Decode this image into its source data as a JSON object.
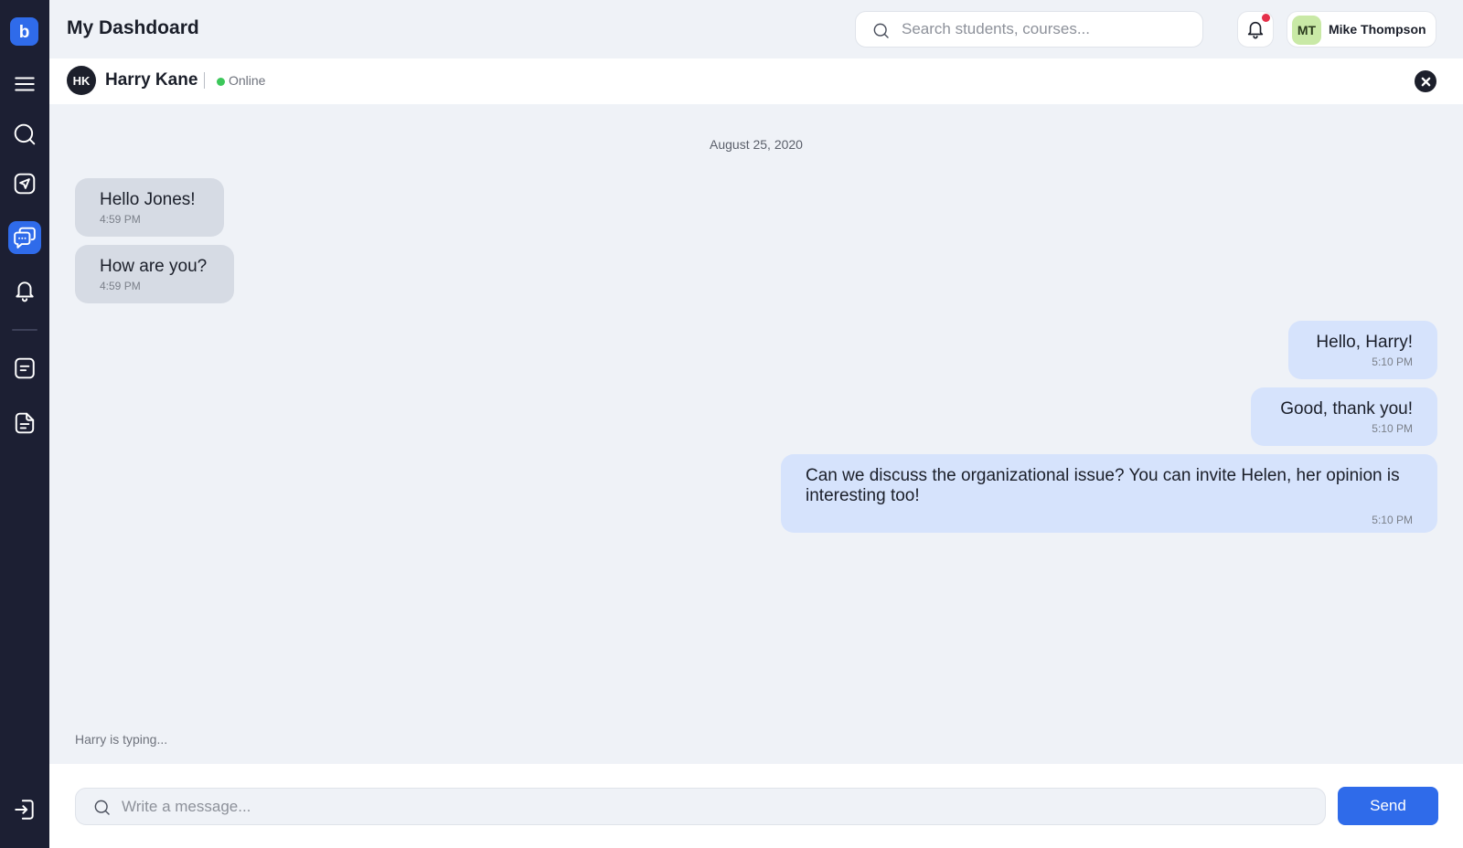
{
  "app": {
    "logo_letter": "b",
    "title": "My Dashdoard"
  },
  "sidebar": {
    "items": [
      {
        "icon": "menu-icon"
      },
      {
        "icon": "search-icon"
      },
      {
        "icon": "send-icon"
      },
      {
        "icon": "chat-icon",
        "active": true
      },
      {
        "icon": "bell-icon"
      },
      {
        "icon": "note-icon"
      },
      {
        "icon": "document-icon"
      },
      {
        "icon": "logout-icon"
      }
    ]
  },
  "header": {
    "search_placeholder": "Search students, courses...",
    "notification_dot_color": "#e5304a",
    "user": {
      "initials": "MT",
      "name": "Mike Thompson"
    }
  },
  "chat": {
    "contact": {
      "initials": "HK",
      "name": "Harry Kane",
      "status": "Online"
    },
    "date": "August 25, 2020",
    "messages": [
      {
        "direction": "in",
        "text": "Hello Jones!",
        "time": "4:59 PM"
      },
      {
        "direction": "in",
        "text": "How are you?",
        "time": "4:59 PM"
      },
      {
        "direction": "out",
        "text": "Hello, Harry!",
        "time": "5:10 PM"
      },
      {
        "direction": "out",
        "text": "Good, thank you!",
        "time": "5:10 PM"
      },
      {
        "direction": "out",
        "text": "Can we discuss the organizational issue? You can invite Helen, her opinion is interesting too!",
        "time": "5:10 PM"
      }
    ],
    "typing": "Harry is typing..."
  },
  "composer": {
    "placeholder": "Write a message...",
    "send_label": "Send"
  },
  "colors": {
    "accent": "#2f6bea",
    "sidebar": "#1c1f33",
    "online": "#3cc75a",
    "incoming_bubble": "#d6dbe4",
    "outgoing_bubble": "#d6e3fc"
  }
}
